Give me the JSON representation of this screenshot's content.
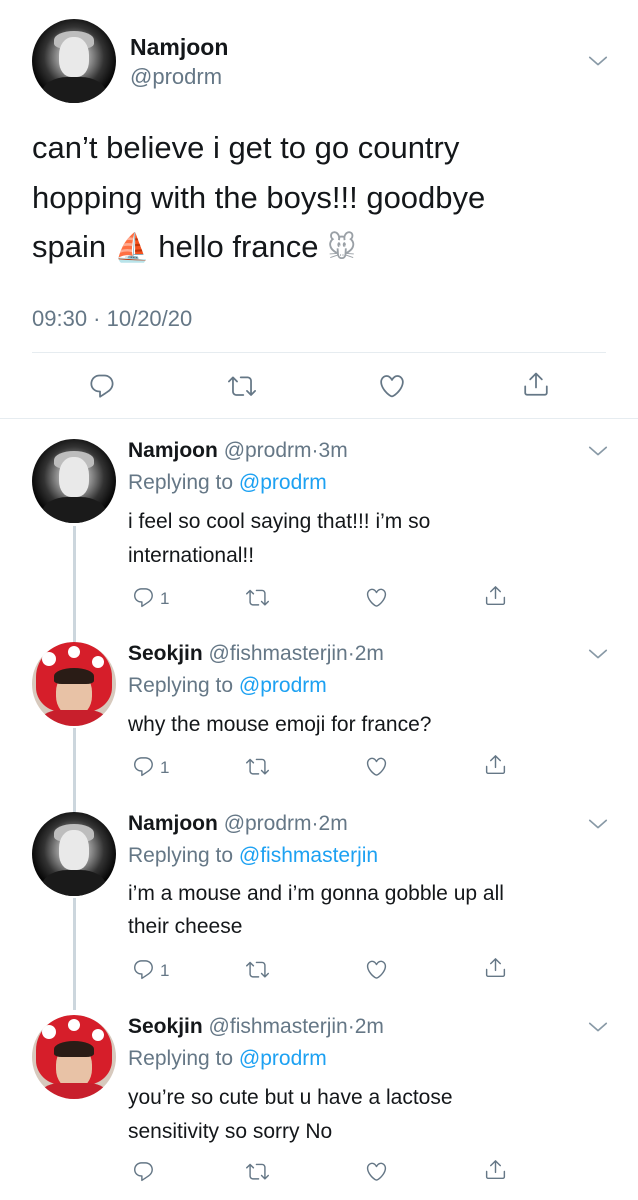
{
  "main_tweet": {
    "name": "Namjoon",
    "handle": "@prodrm",
    "text_line1": "can’t believe i get to go country",
    "text_line2": "hopping with the boys!!! goodbye",
    "text_line3a": "spain",
    "text_line3b": "hello france",
    "emoji_sailboat": "⛵",
    "emoji_mouse": "🐭",
    "timestamp": "09:30 · 10/20/20"
  },
  "replies": [
    {
      "name": "Namjoon",
      "handle": "@prodrm",
      "time": "3m",
      "replying_label": "Replying to",
      "replying_to": "@prodrm",
      "line1": "i feel so cool saying that!!! i’m so",
      "line2": "international!!",
      "reply_count": "1"
    },
    {
      "name": "Seokjin",
      "handle": "@fishmasterjin",
      "time": "2m",
      "replying_label": "Replying to",
      "replying_to": "@prodrm",
      "line1": "why the mouse emoji for france?",
      "line2": "",
      "reply_count": "1"
    },
    {
      "name": "Namjoon",
      "handle": "@prodrm",
      "time": "2m",
      "replying_label": "Replying to",
      "replying_to": "@fishmasterjin",
      "line1": "i’m a mouse and i’m gonna gobble up all",
      "line2": "their cheese",
      "reply_count": "1"
    },
    {
      "name": "Seokjin",
      "handle": "@fishmasterjin",
      "time": "2m",
      "replying_label": "Replying to",
      "replying_to": "@prodrm",
      "line1": "you’re so cute but u have a lactose",
      "line2": "sensitivity so sorry No",
      "reply_count": ""
    }
  ],
  "dot": "·",
  "icons": {
    "reply": "reply-icon",
    "retweet": "retweet-icon",
    "like": "like-icon",
    "share": "share-icon",
    "chevron": "chevron-down-icon"
  },
  "colors": {
    "link": "#1da1f2",
    "muted": "#657786",
    "text": "#14171a",
    "divider": "#e6ecf0"
  }
}
